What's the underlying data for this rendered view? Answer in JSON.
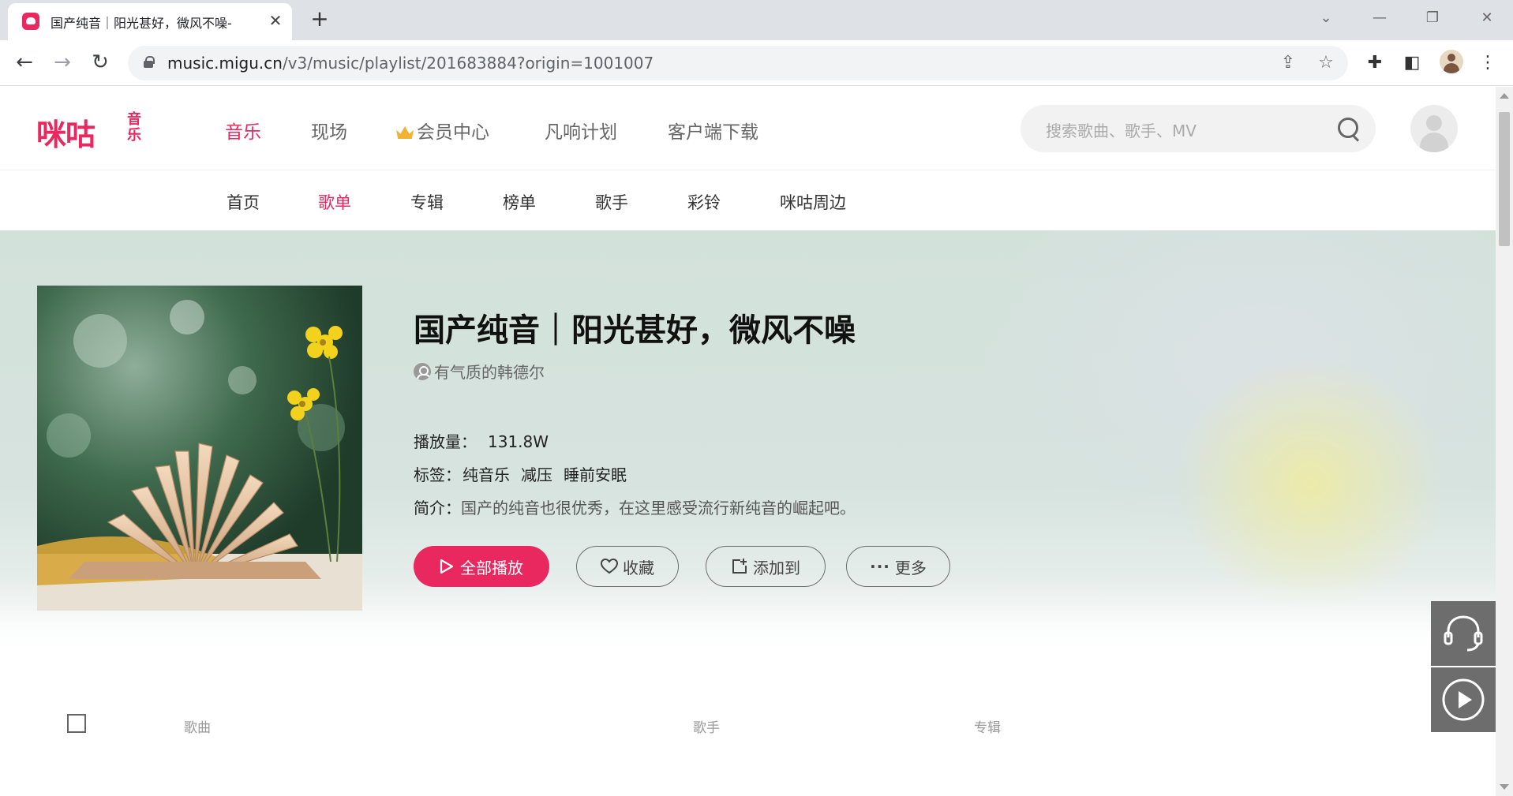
{
  "browser": {
    "tab_title": "国产纯音｜阳光甚好，微风不噪-",
    "url_main": "music.migu.cn",
    "url_rest": "/v3/music/playlist/201683884?origin=1001007"
  },
  "site": {
    "logo_text": "咪咕",
    "logo_sub": "音乐",
    "main_nav": [
      "音乐",
      "现场",
      "会员中心",
      "凡响计划",
      "客户端下载"
    ],
    "search_placeholder": "搜索歌曲、歌手、MV",
    "sub_nav": [
      "首页",
      "歌单",
      "专辑",
      "榜单",
      "歌手",
      "彩铃",
      "咪咕周边"
    ]
  },
  "playlist": {
    "title": "国产纯音｜阳光甚好，微风不噪",
    "creator": "有气质的韩德尔",
    "play_count_label": "播放量：",
    "play_count": "131.8W",
    "tags_label": "标签：",
    "tags": [
      "纯音乐",
      "减压",
      "睡前安眠"
    ],
    "desc_label": "简介：",
    "description": "国产的纯音也很优秀，在这里感受流行新纯音的崛起吧。",
    "buttons": {
      "play_all": "全部播放",
      "favorite": "收藏",
      "add_to": "添加到",
      "more": "更多"
    }
  },
  "table": {
    "col_song": "歌曲",
    "col_artist": "歌手",
    "col_album": "专辑"
  },
  "colors": {
    "brand": "#e8285f",
    "hero_bg": "#d3e1db",
    "float_btn": "#6d6d6d"
  },
  "icons": [
    "lock-icon",
    "share-icon",
    "star-icon",
    "extensions-icon",
    "sidepanel-icon",
    "profile-icon",
    "menu-icon",
    "search-icon",
    "crown-icon",
    "person-icon",
    "play-icon",
    "heart-icon",
    "add-to-icon",
    "more-icon",
    "headset-icon",
    "play-circle-icon"
  ]
}
